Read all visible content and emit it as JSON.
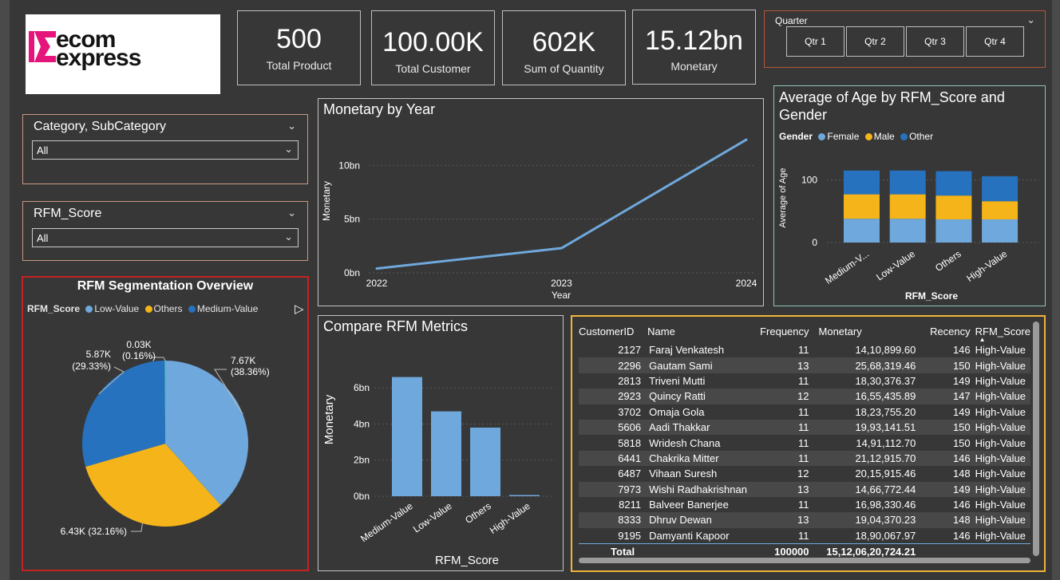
{
  "brand": {
    "logo_line1": "ecom",
    "logo_line2": "express"
  },
  "kpis": [
    {
      "value": "500",
      "label": "Total Product"
    },
    {
      "value": "100.00K",
      "label": "Total Customer"
    },
    {
      "value": "602K",
      "label": "Sum of Quantity"
    },
    {
      "value": "15.12bn",
      "label": "Monetary"
    }
  ],
  "quarter_slicer": {
    "title": "Quarter",
    "options": [
      "Qtr 1",
      "Qtr 2",
      "Qtr 3",
      "Qtr 4"
    ]
  },
  "category_slicer": {
    "title": "Category, SubCategory",
    "value": "All"
  },
  "rfm_slicer": {
    "title": "RFM_Score",
    "value": "All"
  },
  "icons": {
    "chevron": "chevron-down-icon",
    "scroll": "play-right-icon"
  },
  "colors": {
    "light_blue": "#6fa8dc",
    "orange": "#f4b41a",
    "blue": "#2672be",
    "line": "#6fa8dc"
  },
  "chart_data": [
    {
      "id": "monetary_by_year",
      "type": "line",
      "title": "Monetary by Year",
      "xlabel": "Year",
      "ylabel": "Monetary",
      "x": [
        "2022",
        "2023",
        "2024"
      ],
      "values": [
        0.4,
        2.3,
        12.4
      ],
      "yticks": [
        "0bn",
        "5bn",
        "10bn"
      ],
      "ylim": [
        0,
        13
      ],
      "grid": true
    },
    {
      "id": "avg_age",
      "type": "bar",
      "stacked": true,
      "title": "Average of Age by RFM_Score and Gender",
      "xlabel": "RFM_Score",
      "ylabel": "Average of Age",
      "legend_title": "Gender",
      "categories": [
        "Medium-V...",
        "Low-Value",
        "Others",
        "High-Value"
      ],
      "series": [
        {
          "name": "Female",
          "values": [
            38,
            38,
            37,
            37
          ]
        },
        {
          "name": "Male",
          "values": [
            39,
            39,
            38,
            29
          ]
        },
        {
          "name": "Other",
          "values": [
            38,
            38,
            39,
            40
          ]
        }
      ],
      "yticks": [
        "0",
        "100"
      ],
      "ylim": [
        0,
        130
      ]
    },
    {
      "id": "rfm_segmentation",
      "type": "pie",
      "title": "RFM Segmentation Overview",
      "legend_title": "RFM_Score",
      "legend": [
        "Low-Value",
        "Others",
        "Medium-Value"
      ],
      "slices": [
        {
          "name": "Low-Value",
          "value": 7.67,
          "label": "7.67K",
          "pct": "(38.36%)"
        },
        {
          "name": "Others",
          "value": 6.43,
          "label": "6.43K (32.16%)"
        },
        {
          "name": "Medium-Value",
          "value": 5.87,
          "label": "5.87K",
          "pct": "(29.33%)"
        },
        {
          "name": "High-Value",
          "value": 0.03,
          "label": "0.03K",
          "pct": "(0.16%)"
        }
      ]
    },
    {
      "id": "compare_rfm",
      "type": "bar",
      "title": "Compare RFM Metrics",
      "xlabel": "RFM_Score",
      "ylabel": "Monetary",
      "categories": [
        "Medium-Value",
        "Low-Value",
        "Others",
        "High-Value"
      ],
      "values": [
        6.6,
        4.7,
        3.8,
        0.05
      ],
      "yticks": [
        "0bn",
        "2bn",
        "4bn",
        "6bn"
      ],
      "ylim": [
        0,
        7.2
      ]
    }
  ],
  "table": {
    "columns": [
      "CustomerID",
      "Name",
      "Frequency",
      "Monetary",
      "Recency",
      "RFM_Score"
    ],
    "rows": [
      [
        "2127",
        "Faraj Venkatesh",
        "11",
        "14,10,899.60",
        "146",
        "High-Value"
      ],
      [
        "2296",
        "Gautam Sami",
        "13",
        "25,68,319.46",
        "150",
        "High-Value"
      ],
      [
        "2813",
        "Triveni Mutti",
        "11",
        "18,30,376.37",
        "149",
        "High-Value"
      ],
      [
        "2923",
        "Quincy Ratti",
        "12",
        "16,55,435.89",
        "147",
        "High-Value"
      ],
      [
        "3702",
        "Omaja Gola",
        "11",
        "18,23,755.20",
        "149",
        "High-Value"
      ],
      [
        "5606",
        "Aadi Thakkar",
        "11",
        "19,93,141.51",
        "150",
        "High-Value"
      ],
      [
        "5818",
        "Wridesh Chana",
        "11",
        "14,91,112.70",
        "150",
        "High-Value"
      ],
      [
        "6441",
        "Chakrika Mitter",
        "11",
        "21,12,915.70",
        "146",
        "High-Value"
      ],
      [
        "6487",
        "Vihaan Suresh",
        "12",
        "20,15,915.46",
        "148",
        "High-Value"
      ],
      [
        "7973",
        "Wishi Radhakrishnan",
        "13",
        "14,66,772.44",
        "149",
        "High-Value"
      ],
      [
        "8211",
        "Balveer Banerjee",
        "11",
        "16,98,330.46",
        "146",
        "High-Value"
      ],
      [
        "8333",
        "Dhruv Dewan",
        "13",
        "19,04,370.23",
        "148",
        "High-Value"
      ],
      [
        "9195",
        "Damyanti Kapoor",
        "11",
        "18,90,067.97",
        "146",
        "High-Value"
      ]
    ],
    "total_label": "Total",
    "total_frequency": "100000",
    "total_monetary": "15,12,06,20,724.21"
  }
}
